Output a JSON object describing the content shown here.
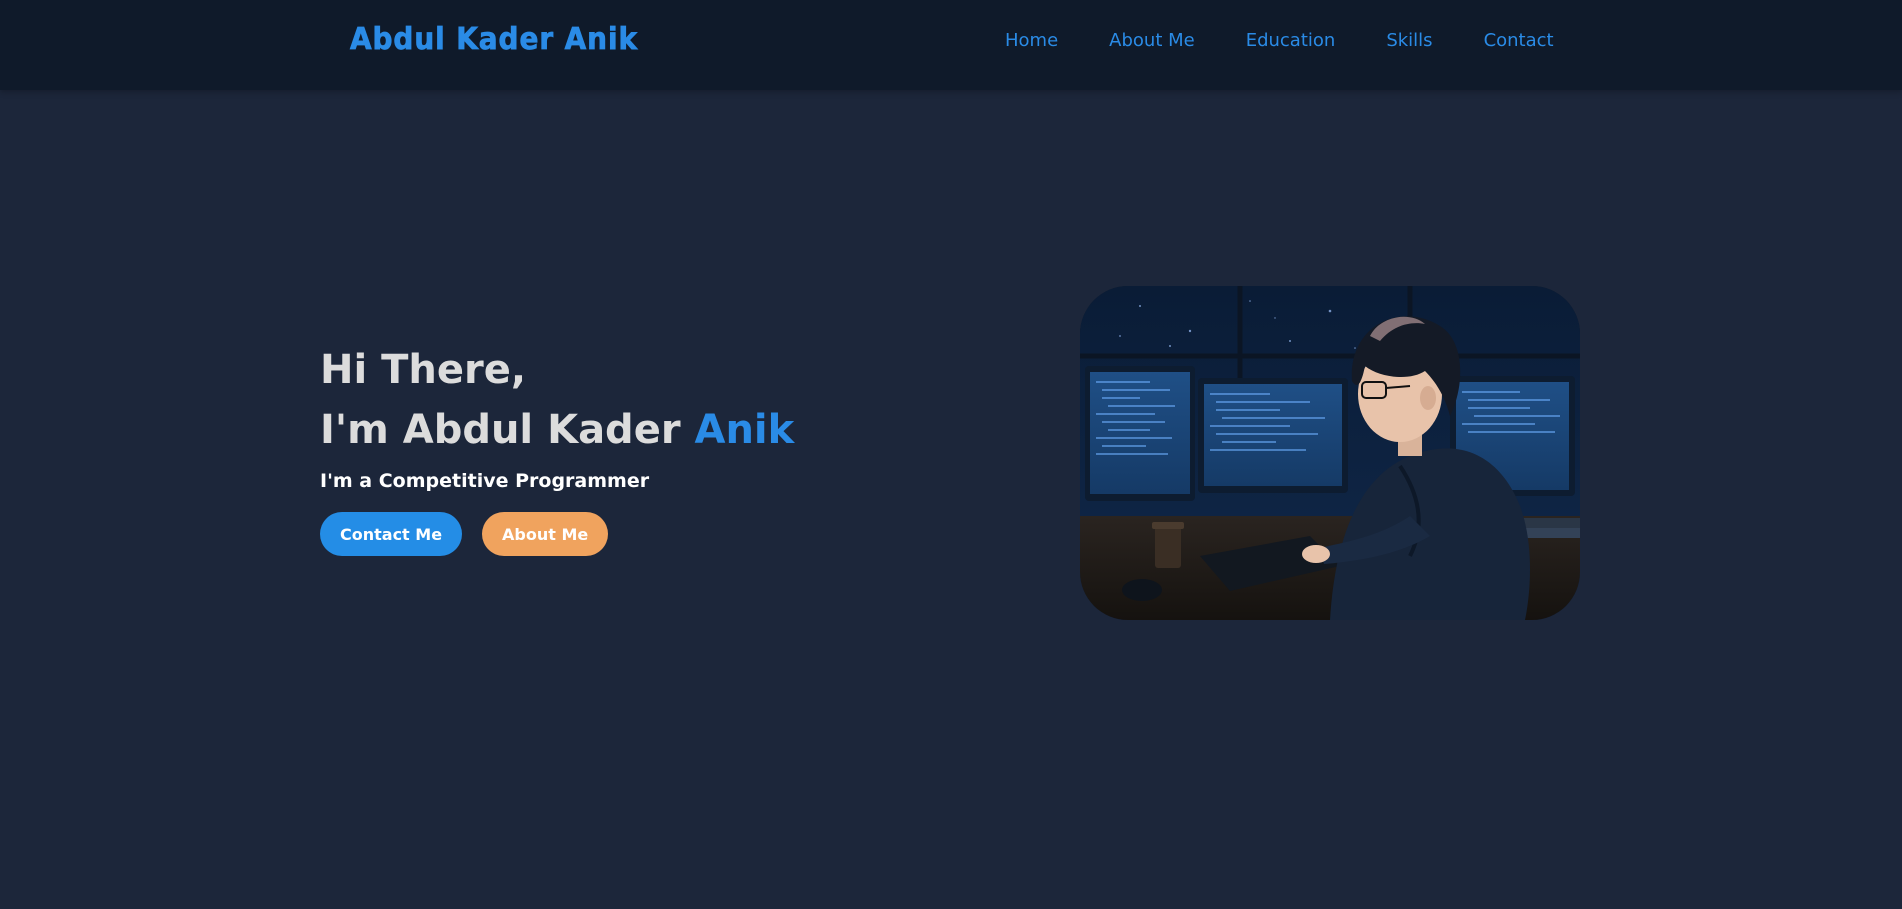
{
  "header": {
    "logo": "Abdul Kader Anik",
    "nav": [
      "Home",
      "About Me",
      "Education",
      "Skills",
      "Contact"
    ]
  },
  "hero": {
    "line1": "Hi There,",
    "line2_prefix": "I'm Abdul Kader ",
    "line2_accent": "Anik",
    "tagline": "I'm a Competitive Programmer",
    "buttons": {
      "contact": "Contact Me",
      "about": "About Me"
    },
    "image_icon": "programmer-illustration"
  },
  "colors": {
    "background": "#1c263a",
    "header": "#0f1a2a",
    "accent": "#2a8be6",
    "secondary_button": "#f0a35e"
  }
}
